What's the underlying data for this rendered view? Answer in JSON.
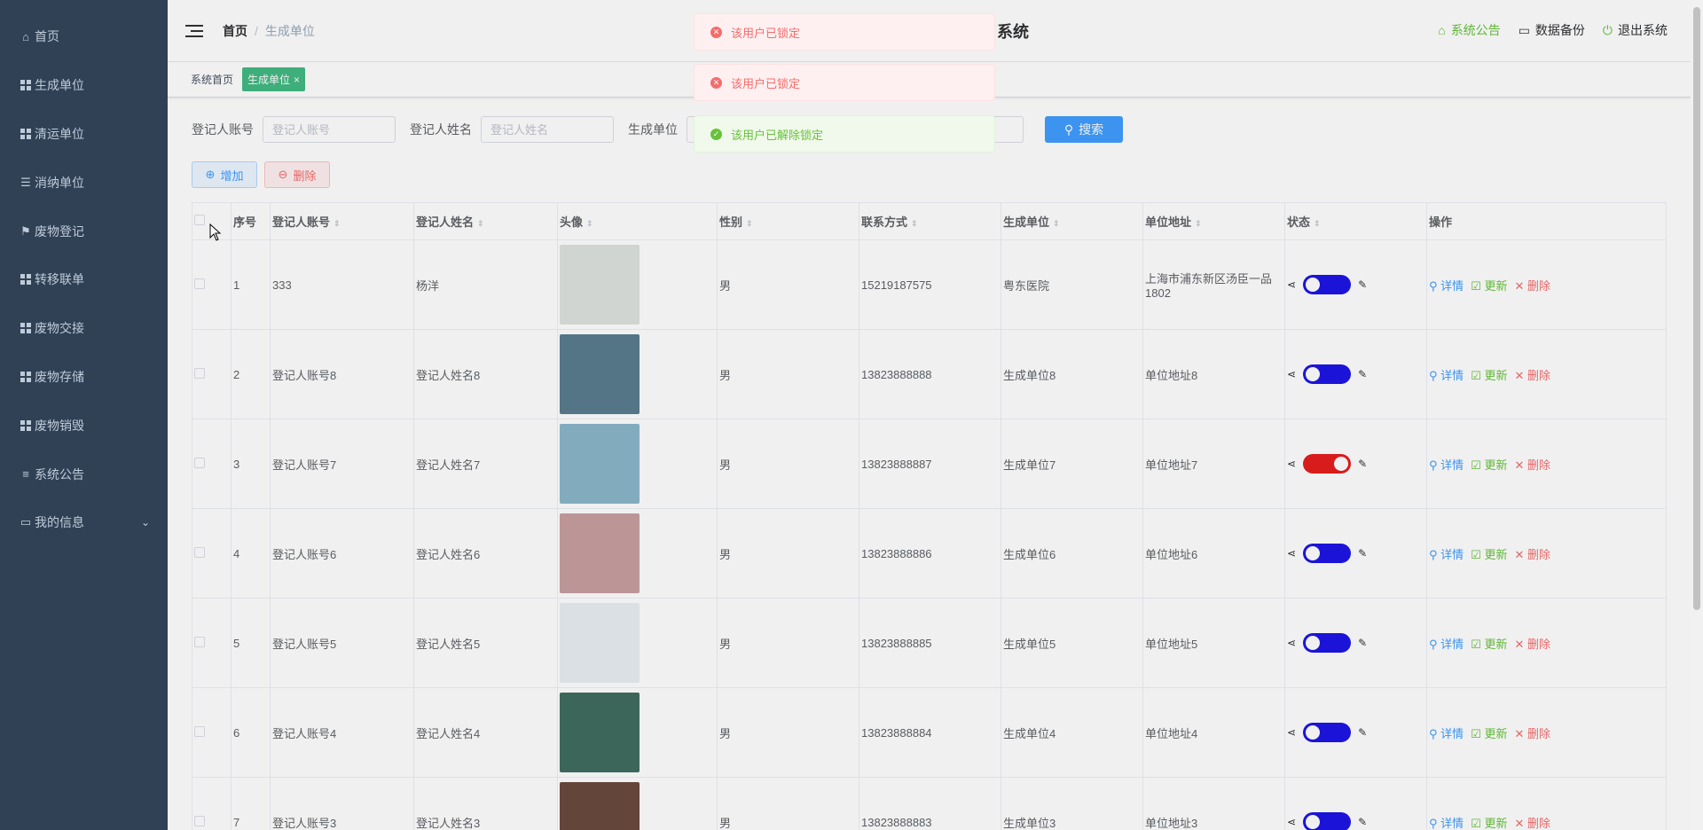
{
  "sidebar": {
    "items": [
      {
        "label": "首页",
        "icon": "home-icon"
      },
      {
        "label": "生成单位",
        "icon": "grid-icon"
      },
      {
        "label": "清运单位",
        "icon": "grid-icon"
      },
      {
        "label": "消纳单位",
        "icon": "sliders-icon"
      },
      {
        "label": "废物登记",
        "icon": "flag-icon"
      },
      {
        "label": "转移联单",
        "icon": "grid-icon"
      },
      {
        "label": "废物交接",
        "icon": "grid-icon"
      },
      {
        "label": "废物存储",
        "icon": "grid-icon"
      },
      {
        "label": "废物销毁",
        "icon": "grid-icon"
      },
      {
        "label": "系统公告",
        "icon": "list-icon"
      },
      {
        "label": "我的信息",
        "icon": "card-icon"
      }
    ]
  },
  "navbar": {
    "breadcrumb_home": "首页",
    "breadcrumb_current": "生成单位",
    "system_title": "系统",
    "announcement": "系统公告",
    "backup": "数据备份",
    "logout": "退出系统"
  },
  "tags": {
    "home": "系统首页",
    "active": "生成单位"
  },
  "search": {
    "account_label": "登记人账号",
    "account_placeholder": "登记人账号",
    "name_label": "登记人姓名",
    "name_placeholder": "登记人姓名",
    "unit_label": "生成单位",
    "button": "搜索"
  },
  "actions": {
    "add": "增加",
    "delete": "删除"
  },
  "table": {
    "headers": [
      "序号",
      "登记人账号",
      "登记人姓名",
      "头像",
      "性别",
      "联系方式",
      "生成单位",
      "单位地址",
      "状态",
      "操作"
    ],
    "rows": [
      {
        "idx": "1",
        "account": "333",
        "name": "杨洋",
        "gender": "男",
        "phone": "15219187575",
        "unit": "粤东医院",
        "address": "上海市浦东新区汤臣一品1802",
        "locked": false,
        "avatar_color": "#dfe3e0"
      },
      {
        "idx": "2",
        "account": "登记人账号8",
        "name": "登记人姓名8",
        "gender": "男",
        "phone": "13823888888",
        "unit": "生成单位8",
        "address": "单位地址8",
        "locked": false,
        "avatar_color": "#5a7d8f"
      },
      {
        "idx": "3",
        "account": "登记人账号7",
        "name": "登记人姓名7",
        "gender": "男",
        "phone": "13823888887",
        "unit": "生成单位7",
        "address": "单位地址7",
        "locked": true,
        "avatar_color": "#8bb6c9"
      },
      {
        "idx": "4",
        "account": "登记人账号6",
        "name": "登记人姓名6",
        "gender": "男",
        "phone": "13823888886",
        "unit": "生成单位6",
        "address": "单位地址6",
        "locked": false,
        "avatar_color": "#c89fa0"
      },
      {
        "idx": "5",
        "account": "登记人账号5",
        "name": "登记人姓名5",
        "gender": "男",
        "phone": "13823888885",
        "unit": "生成单位5",
        "address": "单位地址5",
        "locked": false,
        "avatar_color": "#e8eef2"
      },
      {
        "idx": "6",
        "account": "登记人账号4",
        "name": "登记人姓名4",
        "gender": "男",
        "phone": "13823888884",
        "unit": "生成单位4",
        "address": "单位地址4",
        "locked": false,
        "avatar_color": "#3f6d5f"
      },
      {
        "idx": "7",
        "account": "登记人账号3",
        "name": "登记人姓名3",
        "gender": "男",
        "phone": "13823888883",
        "unit": "生成单位3",
        "address": "单位地址3",
        "locked": false,
        "avatar_color": "#6b4a3e"
      }
    ],
    "op_detail": "详情",
    "op_update": "更新",
    "op_delete": "删除"
  },
  "messages": [
    {
      "type": "error",
      "text": "该用户已锁定"
    },
    {
      "type": "error",
      "text": "该用户已锁定"
    },
    {
      "type": "success",
      "text": "该用户已解除锁定"
    }
  ],
  "colors": {
    "sidebar_bg": "#304156",
    "switch_off": "#1d16e6",
    "switch_on": "#e61d1d",
    "primary": "#409eff"
  }
}
